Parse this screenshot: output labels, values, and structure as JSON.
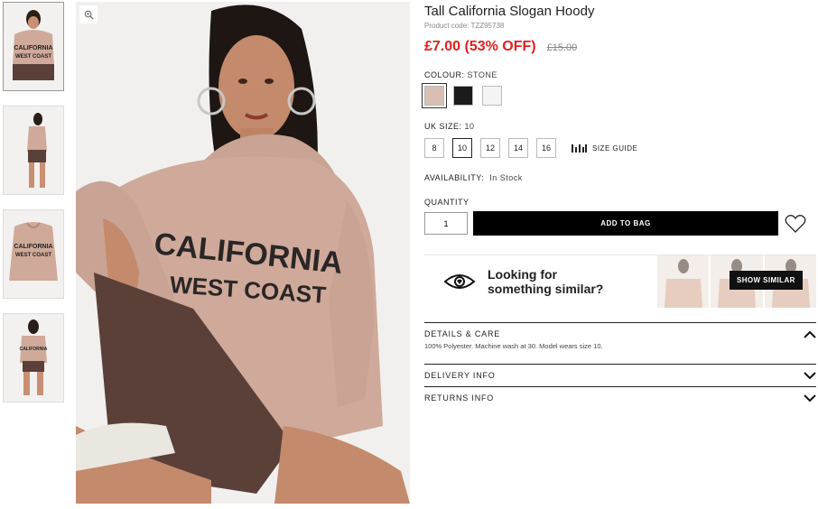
{
  "product": {
    "title": "Tall California Slogan Hoody",
    "code": "Product code: TZZ95738",
    "price": "£7.00 (53% OFF)",
    "was_price": "£15.00",
    "hoodie_print_line1": "CALIFORNIA",
    "hoodie_print_line2": "WEST COAST"
  },
  "colour": {
    "label": "COLOUR:",
    "value": "STONE",
    "swatches": [
      "#d9bfb3",
      "#1b1b1b",
      "#f4f4f4"
    ]
  },
  "size": {
    "label": "UK SIZE:",
    "value": "10",
    "options": [
      "8",
      "10",
      "12",
      "14",
      "16"
    ],
    "guide_label": "SIZE GUIDE"
  },
  "availability": {
    "label": "AVAILABILITY:",
    "value": "In Stock"
  },
  "quantity": {
    "label": "QUANTITY",
    "value": "1"
  },
  "add_to_bag": "ADD TO BAG",
  "similar": {
    "line1": "Looking for",
    "line2": "something similar?",
    "button": "SHOW SIMILAR"
  },
  "accordion": {
    "details_title": "DETAILS & CARE",
    "details_body": "100% Polyester. Machine wash at 30. Model wears size 10.",
    "delivery_title": "DELIVERY INFO",
    "returns_title": "RETURNS INFO"
  },
  "colors": {
    "price_red": "#e02020",
    "hoodie": "#cfa99a",
    "shorts": "#5a4038"
  }
}
